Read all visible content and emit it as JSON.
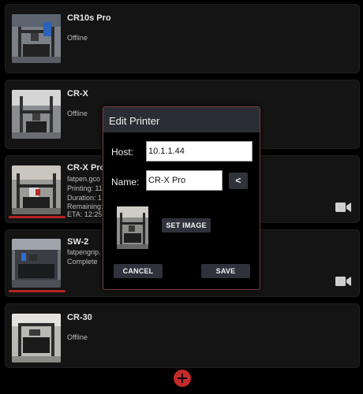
{
  "printers": [
    {
      "name": "CR10s Pro",
      "status": "Offline"
    },
    {
      "name": "CR-X",
      "status": "Offline"
    },
    {
      "name": "CR-X Pro",
      "lines": [
        "fatpen.gco",
        "Printing: 11",
        "Duration: 1",
        "Remaining:",
        "ETA: 12:25"
      ]
    },
    {
      "name": "SW-2",
      "lines": [
        "fatpengrip.",
        "Complete"
      ]
    },
    {
      "name": "CR-30",
      "status": "Offline"
    }
  ],
  "dialog": {
    "title": "Edit Printer",
    "host_label": "Host:",
    "host_value": "10.1.1.44",
    "name_label": "Name:",
    "name_value": "CR-X Pro",
    "arrow_label": "<",
    "set_image_label": "SET IMAGE",
    "cancel_label": "CANCEL",
    "save_label": "SAVE"
  },
  "colors": {
    "accent": "#c42a2a",
    "dialog_header": "#2a2d33",
    "button": "#2f323b",
    "card": "#141414"
  },
  "icons": {
    "camera": "camera-icon",
    "add": "plus-icon"
  }
}
